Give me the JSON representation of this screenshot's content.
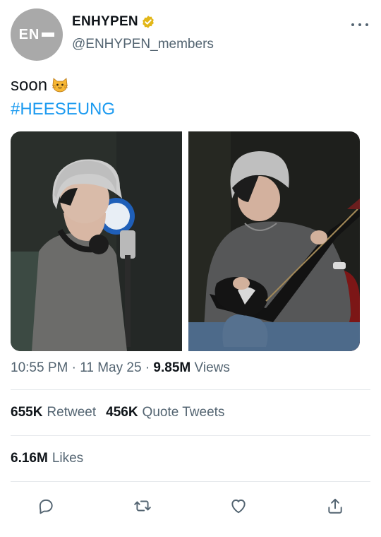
{
  "header": {
    "avatar_text": "EN",
    "display_name": "ENHYPEN",
    "handle": "@ENHYPEN_members",
    "verified_icon": "verified-badge-icon",
    "more_icon": "more-horizontal-icon"
  },
  "tweet": {
    "text": "soon",
    "emoji": "cat-face-emoji",
    "hashtag": "#HEESEUNG",
    "images": [
      {
        "description_icon": "photo",
        "alt": ""
      },
      {
        "description_icon": "photo",
        "alt": ""
      }
    ]
  },
  "meta": {
    "time": "10:55 PM",
    "separator": " · ",
    "date": "11 May 25",
    "views_count": "9.85M",
    "views_label": "Views"
  },
  "stats": {
    "retweets_count": "655K",
    "retweets_label": "Retweet",
    "quotes_count": "456K",
    "quotes_label": "Quote Tweets",
    "likes_count": "6.16M",
    "likes_label": "Likes"
  },
  "actions": {
    "reply": "reply-icon",
    "retweet": "retweet-icon",
    "like": "like-heart-icon",
    "share": "share-icon"
  },
  "colors": {
    "accent": "#1d9bf0",
    "verified": "#e2b719",
    "muted": "#536471",
    "text": "#0f1419"
  }
}
